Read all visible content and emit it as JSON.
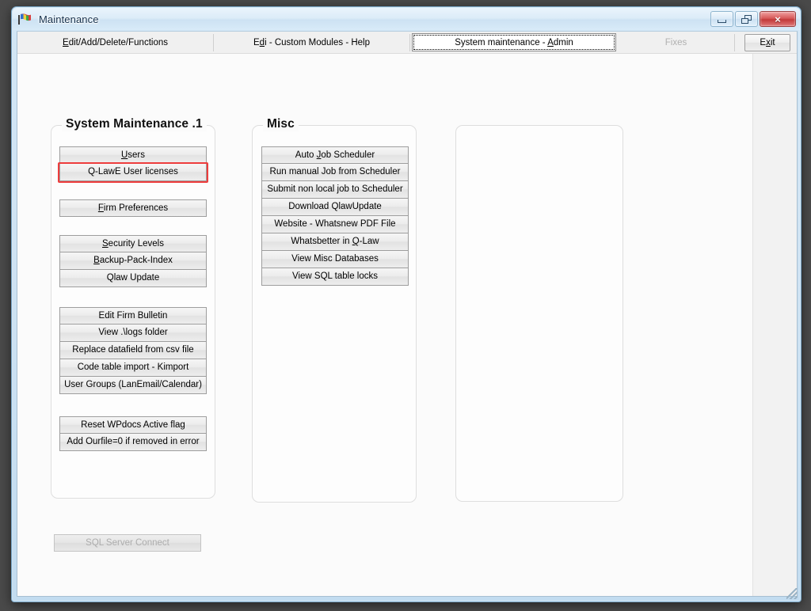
{
  "window": {
    "title": "Maintenance",
    "app_icon": "windows-flag-icon",
    "controls": {
      "minimize": "minimize-icon",
      "restore": "restore-icon",
      "close": "×"
    }
  },
  "tabs": [
    {
      "label": "Edit/Add/Delete/Functions",
      "mnemonic": "E",
      "selected": false,
      "disabled": false
    },
    {
      "label": "Edi - Custom Modules - Help",
      "mnemonic": "d",
      "selected": false,
      "disabled": false
    },
    {
      "label": "System maintenance - Admin",
      "mnemonic": "A",
      "selected": true,
      "disabled": false
    },
    {
      "label": "Fixes",
      "mnemonic": "",
      "selected": false,
      "disabled": true
    }
  ],
  "exit_button": {
    "label": "Exit",
    "mnemonic": "x"
  },
  "panels": {
    "system_maintenance": {
      "title": "System Maintenance .1",
      "groups": [
        {
          "buttons": [
            {
              "label": "Users",
              "mnemonic": "U",
              "highlighted": false
            },
            {
              "label": "Q-LawE User licenses",
              "mnemonic": "",
              "highlighted": true
            }
          ]
        },
        {
          "buttons": [
            {
              "label": "Firm Preferences",
              "mnemonic": "F",
              "highlighted": false
            }
          ]
        },
        {
          "buttons": [
            {
              "label": "Security Levels",
              "mnemonic": "S",
              "highlighted": false
            },
            {
              "label": "Backup-Pack-Index",
              "mnemonic": "B",
              "highlighted": false
            },
            {
              "label": "Qlaw Update",
              "mnemonic": "",
              "highlighted": false
            }
          ]
        },
        {
          "buttons": [
            {
              "label": "Edit Firm Bulletin",
              "mnemonic": "",
              "highlighted": false
            },
            {
              "label": "View .\\logs folder",
              "mnemonic": "",
              "highlighted": false
            },
            {
              "label": "Replace datafield from csv file",
              "mnemonic": "",
              "highlighted": false
            },
            {
              "label": "Code table import - Kimport",
              "mnemonic": "",
              "highlighted": false
            },
            {
              "label": "User Groups (LanEmail/Calendar)",
              "mnemonic": "",
              "highlighted": false
            }
          ]
        },
        {
          "buttons": [
            {
              "label": "Reset WPdocs Active flag",
              "mnemonic": "",
              "highlighted": false
            },
            {
              "label": "Add Ourfile=0 if removed in error",
              "mnemonic": "",
              "highlighted": false
            }
          ]
        }
      ]
    },
    "misc": {
      "title": "Misc",
      "buttons": [
        {
          "label": "Auto Job Scheduler",
          "mnemonic": "J"
        },
        {
          "label": "Run manual Job from Scheduler",
          "mnemonic": ""
        },
        {
          "label": "Submit non local job to Scheduler",
          "mnemonic": ""
        },
        {
          "label": "Download QlawUpdate",
          "mnemonic": ""
        },
        {
          "label": "Website - Whatsnew PDF File",
          "mnemonic": ""
        },
        {
          "label": "Whatsbetter in Q-Law",
          "mnemonic": "Q"
        },
        {
          "label": "View Misc Databases",
          "mnemonic": ""
        },
        {
          "label": "View SQL table locks",
          "mnemonic": ""
        }
      ]
    },
    "empty_panel": {
      "title": ""
    }
  },
  "sql_connect_button": {
    "label": "SQL Server Connect",
    "disabled": true
  },
  "colors": {
    "highlight": "#ee3d3d",
    "title_text": "#16314d",
    "button_face": "#ececec",
    "selected_tab_bg": "#ffffff",
    "disabled_text": "#b0b0b0",
    "window_frame": "#cfe3f3"
  }
}
